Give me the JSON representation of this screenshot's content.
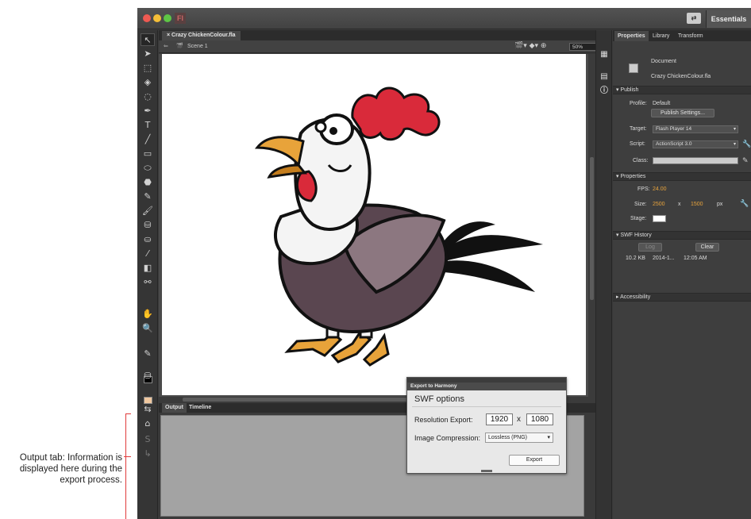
{
  "annotation": {
    "text": "Output tab: Information is displayed here during the export process."
  },
  "titlebar": {
    "app_logo": "Fl",
    "workspace_button": "Essentials"
  },
  "document": {
    "tab_title": "Crazy ChickenColour.fla",
    "scene_label": "Scene 1",
    "zoom": "50%"
  },
  "bottom_panel": {
    "tabs": [
      "Output",
      "Timeline"
    ]
  },
  "properties_panel": {
    "tabs": [
      "Properties",
      "Library",
      "Transform"
    ],
    "document_label": "Document",
    "document_name": "Crazy ChickenColour.fla",
    "publish": {
      "header": "Publish",
      "profile_label": "Profile:",
      "profile_value": "Default",
      "publish_settings_button": "Publish Settings...",
      "target_label": "Target:",
      "target_value": "Flash Player 14",
      "script_label": "Script:",
      "script_value": "ActionScript 3.0",
      "class_label": "Class:"
    },
    "properties": {
      "header": "Properties",
      "fps_label": "FPS:",
      "fps_value": "24.00",
      "size_label": "Size:",
      "width": "2500",
      "x": "x",
      "height": "1500",
      "unit": "px",
      "stage_label": "Stage:"
    },
    "swf_history": {
      "header": "SWF History",
      "log_button": "Log",
      "clear_button": "Clear",
      "size": "10.2 KB",
      "date": "2014-1...",
      "time": "12:05 AM"
    },
    "accessibility": {
      "header": "Accessibility"
    }
  },
  "export_dialog": {
    "title": "Export to Harmony",
    "section": "SWF options",
    "resolution_label": "Resolution Export:",
    "resolution_width": "1920",
    "resolution_x": "x",
    "resolution_height": "1080",
    "compression_label": "Image Compression:",
    "compression_value": "Lossless (PNG)",
    "export_button": "Export"
  },
  "colors": {
    "stage": "#ffffff",
    "accent_value": "#e6a23c",
    "annotation_line": "#e03a3a",
    "output_area": "#a3a3a3"
  }
}
